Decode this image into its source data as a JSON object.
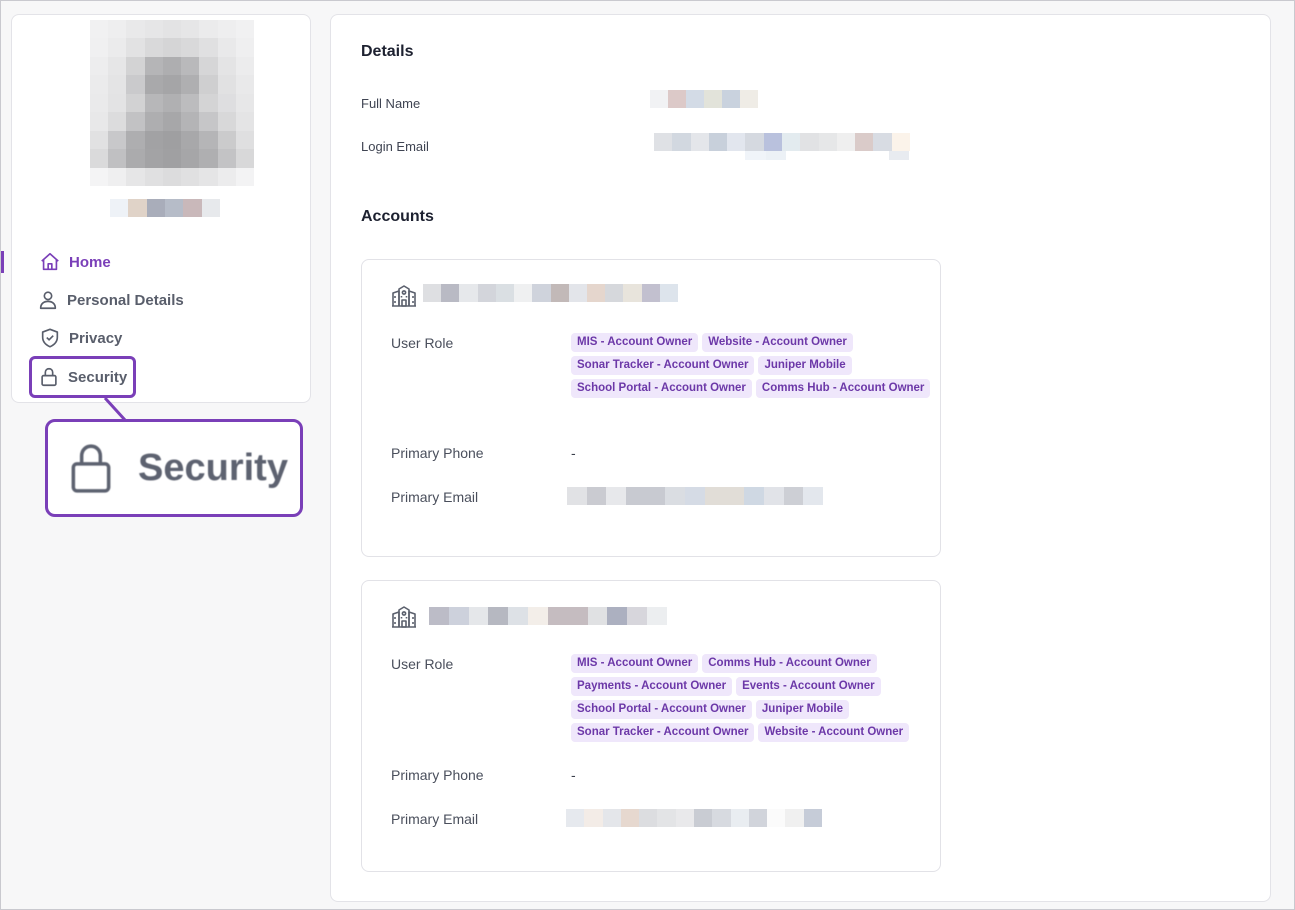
{
  "sidebar": {
    "items": [
      {
        "label": "Home",
        "icon": "home-icon",
        "active": true
      },
      {
        "label": "Personal Details",
        "icon": "user-icon"
      },
      {
        "label": "Privacy",
        "icon": "shield-check-icon"
      },
      {
        "label": "Security",
        "icon": "lock-icon",
        "highlighted": true
      }
    ],
    "callout_label": "Security"
  },
  "details": {
    "title": "Details",
    "full_name_label": "Full Name",
    "login_email_label": "Login Email"
  },
  "accounts": {
    "title": "Accounts",
    "list": [
      {
        "user_role_label": "User Role",
        "roles": [
          "MIS - Account Owner",
          "Website - Account Owner",
          "Sonar Tracker - Account Owner",
          "Juniper Mobile",
          "School Portal - Account Owner",
          "Comms Hub - Account Owner"
        ],
        "primary_phone_label": "Primary Phone",
        "primary_phone": "-",
        "primary_email_label": "Primary Email"
      },
      {
        "user_role_label": "User Role",
        "roles": [
          "MIS - Account Owner",
          "Comms Hub - Account Owner",
          "Payments - Account Owner",
          "Events - Account Owner",
          "School Portal - Account Owner",
          "Juniper Mobile",
          "Sonar Tracker - Account Owner",
          "Website - Account Owner"
        ],
        "primary_phone_label": "Primary Phone",
        "primary_phone": "-",
        "primary_email_label": "Primary Email"
      }
    ]
  },
  "colors": {
    "accent": "#7a3fb8",
    "badge_bg": "#efe7fb",
    "badge_text": "#6c38a8"
  }
}
